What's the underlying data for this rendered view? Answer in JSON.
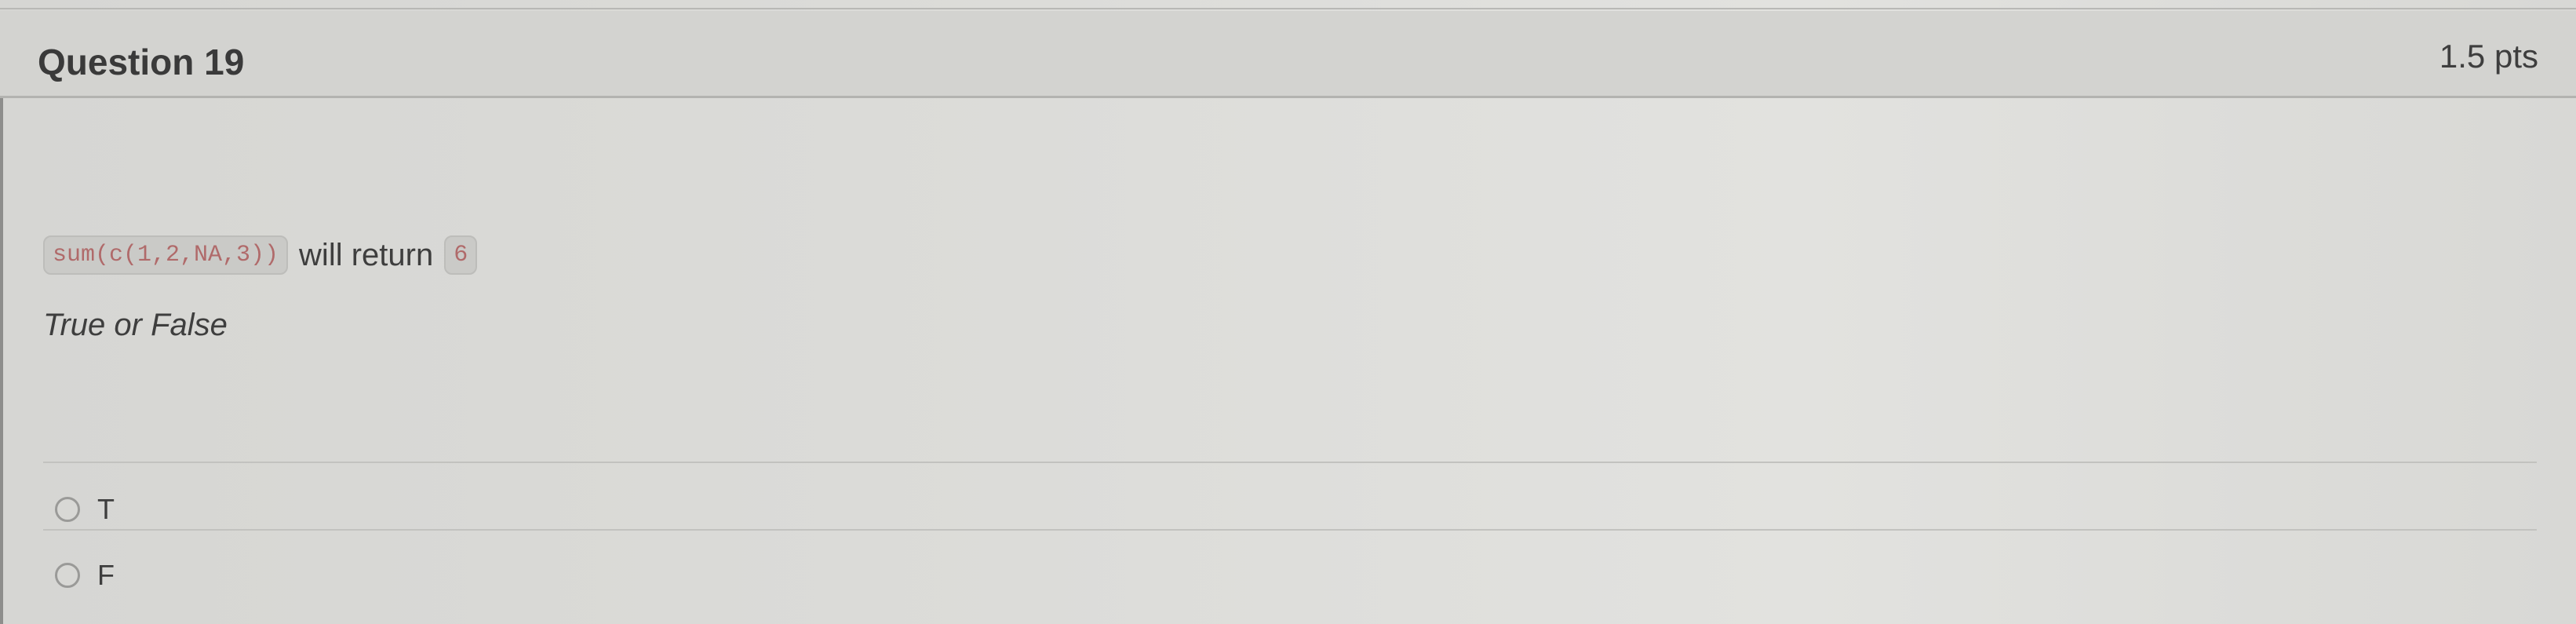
{
  "question": {
    "title": "Question 19",
    "points": "1.5 pts",
    "code": "sum(c(1,2,NA,3))",
    "text": "will return",
    "value": "6",
    "instruction": "True or False",
    "options": [
      {
        "label": "T",
        "selected": false
      },
      {
        "label": "F",
        "selected": false
      }
    ]
  },
  "colors": {
    "code_text": "#b06a6a",
    "header_bg": "#d3d3d0"
  }
}
